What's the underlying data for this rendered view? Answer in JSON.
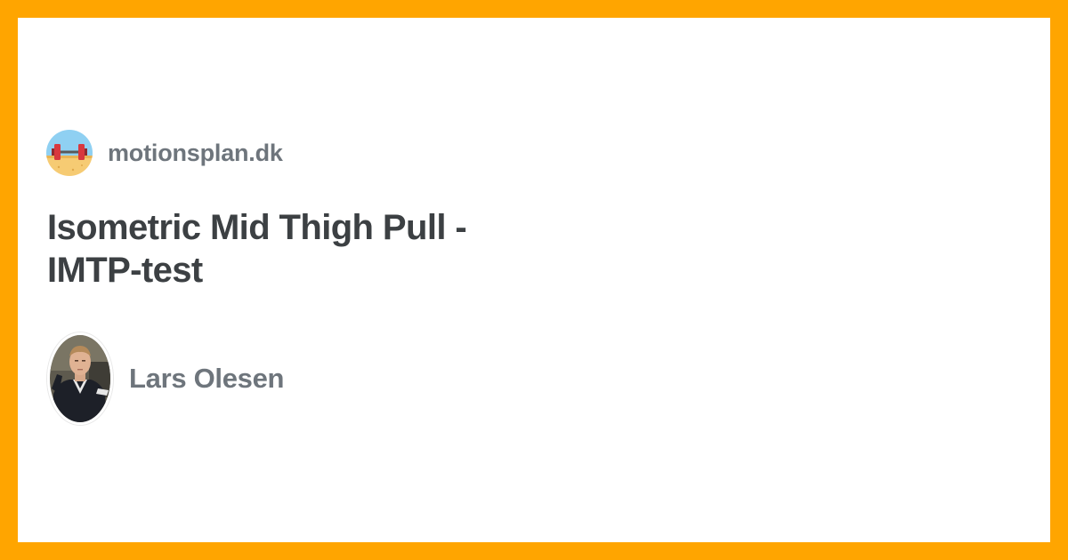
{
  "site": {
    "name": "motionsplan.dk",
    "logo_icon": "dumbbell-beach-icon"
  },
  "article": {
    "title": "Isometric Mid Thigh Pull - IMTP-test"
  },
  "author": {
    "name": "Lars Olesen",
    "avatar_icon": "author-photo"
  },
  "colors": {
    "frame": "#FFA500",
    "background": "#FFFFFF",
    "title": "#3C4043",
    "muted_text": "#6E757C"
  }
}
